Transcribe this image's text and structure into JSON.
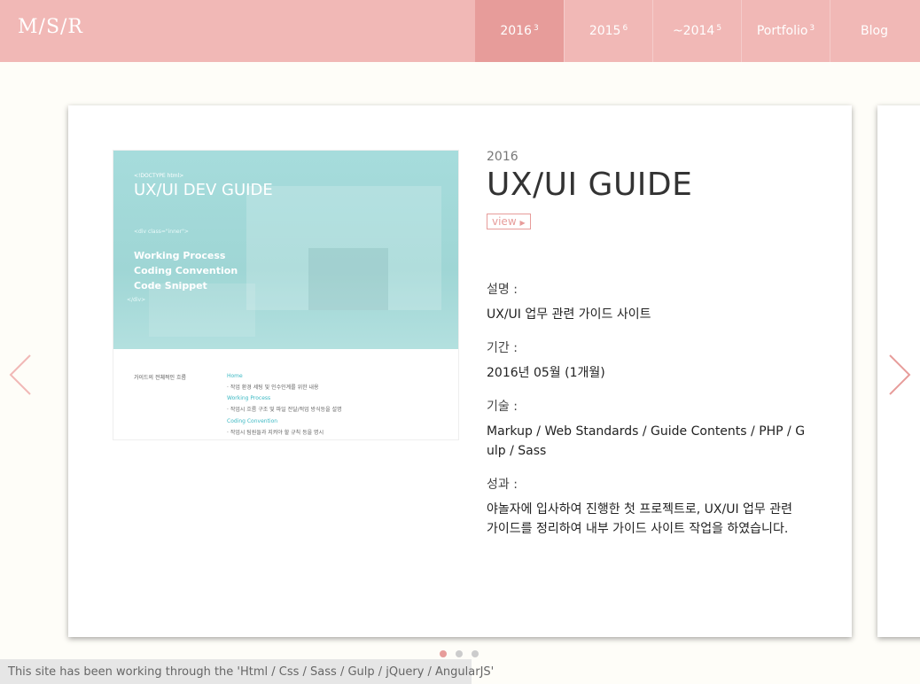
{
  "header": {
    "logo": "M/S/R",
    "nav": [
      {
        "label": "2016",
        "count": "3",
        "active": true
      },
      {
        "label": "2015",
        "count": "6",
        "active": false
      },
      {
        "label": "~2014",
        "count": "5",
        "active": false
      },
      {
        "label": "Portfolio",
        "count": "3",
        "active": false
      },
      {
        "label": "Blog",
        "count": "",
        "active": false
      }
    ]
  },
  "project": {
    "year": "2016",
    "title": "UX/UI GUIDE",
    "view_label": "view",
    "thumbnail": {
      "doctype": "<!DOCTYPE html>",
      "title": "UX/UI DEV GUIDE",
      "code_open": "<div class=\"inner\">",
      "menu": [
        "Working Process",
        "Coding Convention",
        "Code Snippet"
      ],
      "code_close": "</div>",
      "flow_label": "가이드의 전체적인 흐름",
      "list": [
        {
          "text": "Home",
          "heading": true
        },
        {
          "text": "· 작업 환경 세팅 및 인수인계를 위한 내용",
          "heading": false
        },
        {
          "text": "Working Process",
          "heading": true
        },
        {
          "text": "· 작업시 흐름 구조 및 파일 전달/적업 방식등을 설명",
          "heading": false
        },
        {
          "text": "Coding Convention",
          "heading": true
        },
        {
          "text": "· 작업시 팀원들과 지켜야 할 규칙 등을 명시",
          "heading": false
        }
      ]
    },
    "fields": [
      {
        "label": "설명 :",
        "value": "UX/UI 업무 관련 가이드 사이트"
      },
      {
        "label": "기간 :",
        "value": "2016년 05월 (1개월)"
      },
      {
        "label": "기술 :",
        "value": "Markup / Web Standards / Guide Contents / PHP / Gulp / Sass"
      },
      {
        "label": "성과 :",
        "value": "야놀자에 입사하여 진행한 첫 프로젝트로, UX/UI 업무 관련 가이드를 정리하여 내부 가이드 사이트 작업을 하였습니다."
      }
    ]
  },
  "pager": {
    "count": 3,
    "active_index": 0
  },
  "footer": {
    "note": "This site has been working through the 'Html / Css / Sass / Gulp / jQuery / AngularJS'"
  },
  "colors": {
    "header_bg": "#f1b8b6",
    "accent": "#e79c9a",
    "page_bg": "#fefdf8",
    "thumb_teal": "#a6dcdc"
  },
  "icons": {
    "prev": "chevron-left-icon",
    "next": "chevron-right-icon"
  }
}
